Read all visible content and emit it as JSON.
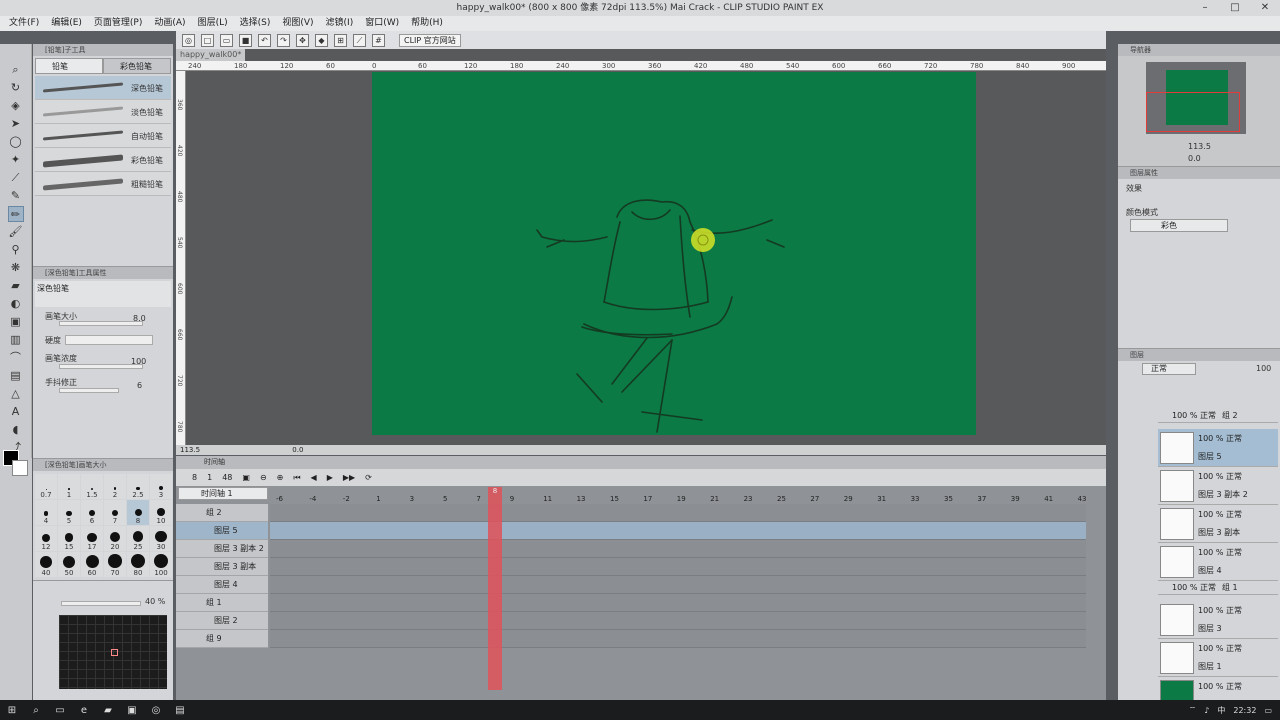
{
  "title": "happy_walk00* (800 x 800 像素 72dpi 113.5%)  Mai Crack - CLIP STUDIO PAINT EX",
  "menu": [
    "文件(F)",
    "编辑(E)",
    "页面管理(P)",
    "动画(A)",
    "图层(L)",
    "选择(S)",
    "视图(V)",
    "滤镜(I)",
    "窗口(W)",
    "帮助(H)"
  ],
  "clip_button": "CLIP 官方网站",
  "subtool": {
    "header": "[铅笔]子工具",
    "tabs": [
      "铅笔",
      "彩色铅笔"
    ],
    "brushes": [
      "深色铅笔",
      "淡色铅笔",
      "自动铅笔",
      "彩色铅笔",
      "粗糙铅笔"
    ]
  },
  "toolprop": {
    "header": "[深色铅笔]工具属性",
    "current": "深色铅笔",
    "brush_size_label": "画笔大小",
    "brush_size": "8.0",
    "hardness_label": "硬度",
    "density_label": "画笔浓度",
    "density": "100",
    "stabilization_label": "手抖修正",
    "stabilization": "6"
  },
  "brushsize": {
    "header": "[深色铅笔]画笔大小",
    "sizes": [
      "0.7",
      "1",
      "1.5",
      "2",
      "2.5",
      "3",
      "4",
      "5",
      "6",
      "7",
      "8",
      "10",
      "12",
      "15",
      "17",
      "20",
      "25",
      "30",
      "40",
      "50",
      "60",
      "70",
      "80",
      "100"
    ],
    "selected": "8"
  },
  "palette": {
    "opacity": "40 %"
  },
  "doc_tab": "happy_walk00*",
  "ruler_h": [
    "240",
    "180",
    "120",
    "60",
    "0",
    "60",
    "120",
    "180",
    "240",
    "300",
    "360",
    "420",
    "480",
    "540",
    "600",
    "660",
    "720",
    "780",
    "840",
    "900"
  ],
  "ruler_v": [
    "360",
    "420",
    "480",
    "540",
    "600",
    "660",
    "720",
    "780"
  ],
  "canvas_status": {
    "zoom": "113.5",
    "angle": "0.0"
  },
  "timeline": {
    "header": "时间轴",
    "frame_start": "8",
    "frame_mid": "1",
    "frame_end": "48",
    "selector": "时间轴 1",
    "rows": [
      {
        "name": "组 2",
        "type": "folder"
      },
      {
        "name": "图层 5",
        "type": "layer",
        "active": true
      },
      {
        "name": "图层 3 副本 2",
        "type": "layer"
      },
      {
        "name": "图层 3 副本",
        "type": "layer"
      },
      {
        "name": "图层 4",
        "type": "layer"
      },
      {
        "name": "组 1",
        "type": "folder"
      },
      {
        "name": "图层 2",
        "type": "layer"
      },
      {
        "name": "组 9",
        "type": "folder"
      }
    ],
    "frame_numbers": [
      "-6",
      "-4",
      "-2",
      "1",
      "3",
      "5",
      "7",
      "9",
      "11",
      "13",
      "15",
      "17",
      "19",
      "21",
      "23",
      "25",
      "27",
      "29",
      "31",
      "33",
      "35",
      "37",
      "39",
      "41",
      "43"
    ],
    "current_frame": "8"
  },
  "navigator": {
    "header": "导航器",
    "zoom": "113.5",
    "angle": "0.0"
  },
  "properties": {
    "header": "图层属性",
    "effect_label": "效果",
    "expression_label": "颜色模式",
    "expression_value": "彩色"
  },
  "layers": {
    "header": "图层",
    "blend_mode": "正常",
    "opacity": "100",
    "items": [
      {
        "kind": "folder",
        "label": "100 % 正常",
        "name": "组 2"
      },
      {
        "kind": "layer",
        "label": "100 % 正常",
        "name": "图层 5",
        "active": true
      },
      {
        "kind": "layer",
        "label": "100 % 正常",
        "name": "图层 3 副本 2"
      },
      {
        "kind": "layer",
        "label": "100 % 正常",
        "name": "图层 3 副本"
      },
      {
        "kind": "layer",
        "label": "100 % 正常",
        "name": "图层 4"
      },
      {
        "kind": "folder",
        "label": "100 % 正常",
        "name": "组 1"
      },
      {
        "kind": "layer",
        "label": "100 % 正常",
        "name": "图层 3"
      },
      {
        "kind": "layer",
        "label": "100 % 正常",
        "name": "图层 1"
      },
      {
        "kind": "paper",
        "label": "100 % 正常",
        "name": ""
      }
    ]
  },
  "colors": {
    "canvas": "#0b7a44",
    "accent": "#e0525a",
    "selection": "#9fb6ca"
  },
  "taskbar": {
    "time": "22:32",
    "ime": "中"
  }
}
